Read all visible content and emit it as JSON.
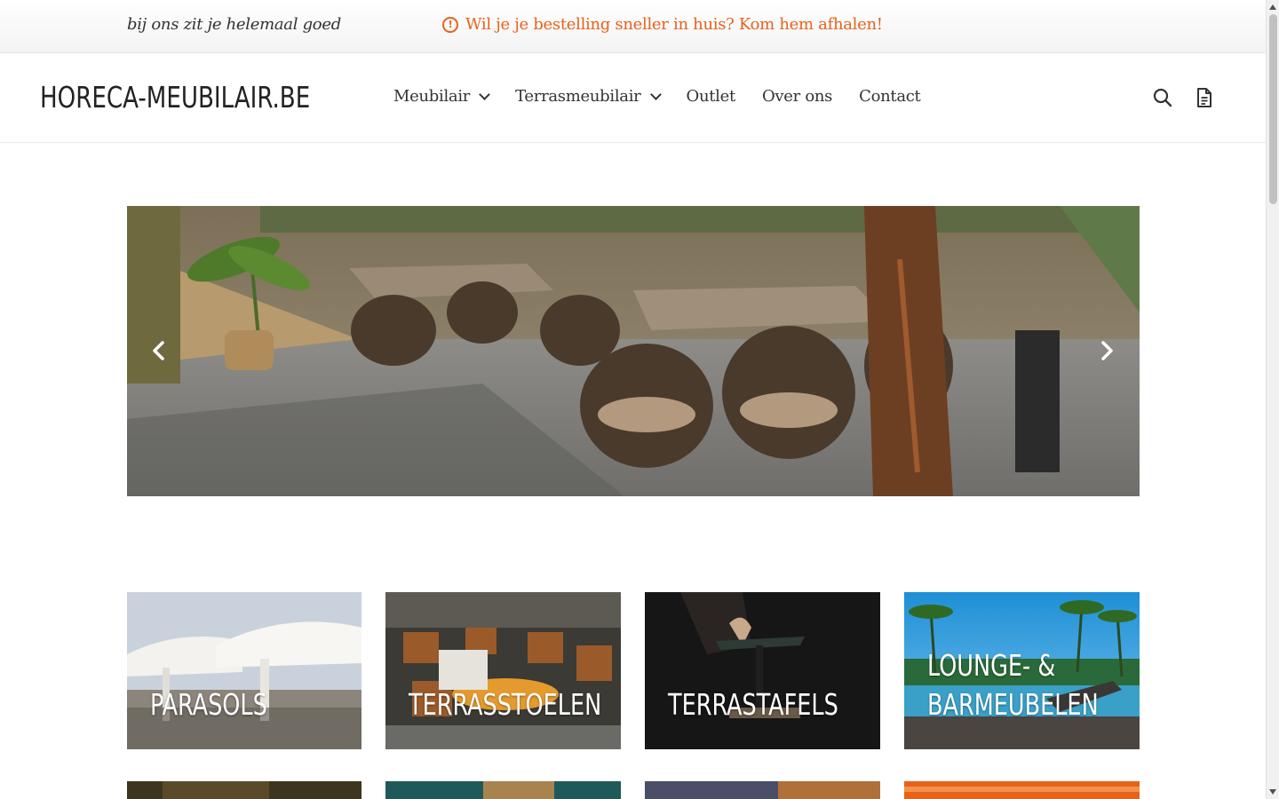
{
  "topbar": {
    "tagline": "bij ons zit je helemaal goed",
    "notice": "Wil je je bestelling sneller in huis? Kom hem afhalen!",
    "notice_icon": "exclamation-circle-icon"
  },
  "header": {
    "logo": "HORECA-MEUBILAIR.BE",
    "nav": [
      {
        "label": "Meubilair",
        "has_dropdown": true
      },
      {
        "label": "Terrasmeubilair",
        "has_dropdown": true
      },
      {
        "label": "Outlet",
        "has_dropdown": false
      },
      {
        "label": "Over ons",
        "has_dropdown": false
      },
      {
        "label": "Contact",
        "has_dropdown": false
      }
    ],
    "icons": [
      "search-icon",
      "document-icon"
    ]
  },
  "slider": {
    "alt": "",
    "prev_icon": "chevron-left-icon",
    "next_icon": "chevron-right-icon"
  },
  "categories": [
    {
      "label": "PARASOLS"
    },
    {
      "label": "TERRASSTOELEN"
    },
    {
      "label": "TERRASTAFELS"
    },
    {
      "label": "LOUNGE- &",
      "label2": "BARMEUBELEN"
    }
  ],
  "colors": {
    "accent": "#e8621a",
    "text": "#333333",
    "header_border": "#e8e8e8"
  }
}
